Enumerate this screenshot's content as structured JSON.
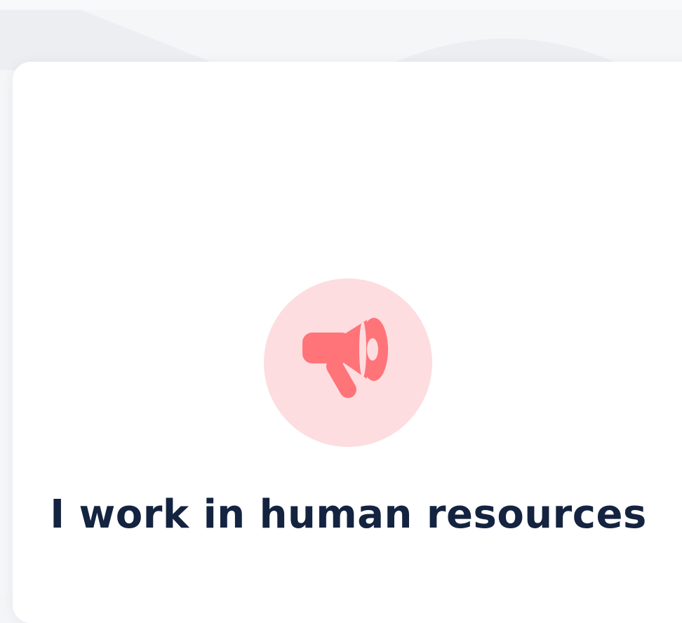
{
  "colors": {
    "page_background": "#f4f5f7",
    "card_background": "#ffffff",
    "icon_circle_background": "#fddde0",
    "icon_color": "#ff7479",
    "title_color": "#14233f"
  },
  "option_card": {
    "icon": "megaphone-icon",
    "title": "I work in human resources"
  }
}
